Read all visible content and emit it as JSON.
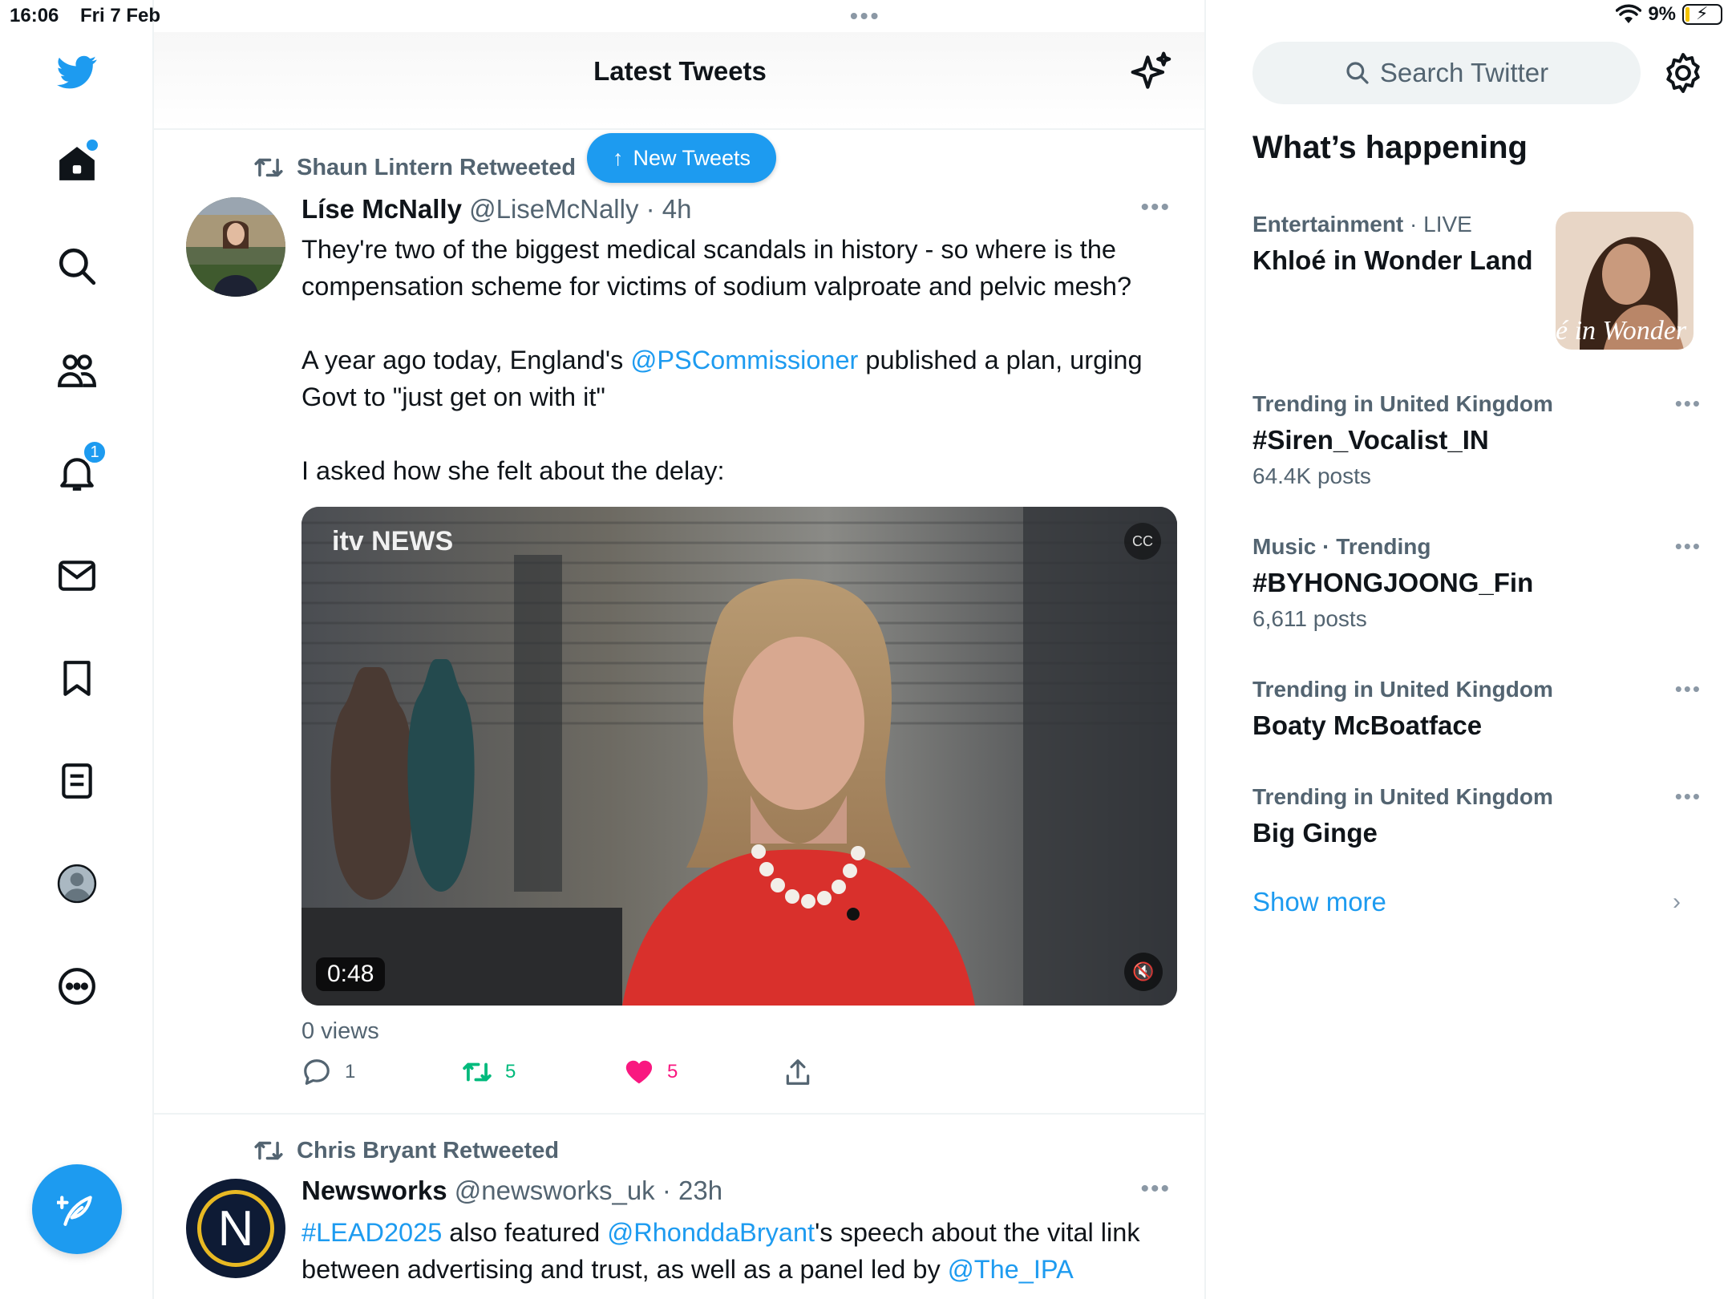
{
  "status_bar": {
    "time": "16:06",
    "date": "Fri 7 Feb",
    "battery": "9%",
    "top_dots": "•••"
  },
  "nav": {
    "notifications_badge": "1"
  },
  "header": {
    "title": "Latest Tweets"
  },
  "new_tweets_pill": {
    "label": "New Tweets"
  },
  "tweets": [
    {
      "retweeted_by": "Shaun Lintern Retweeted",
      "name": "Líse McNally",
      "handle": "@LiseMcNally",
      "time": "4h",
      "text_p1": "They're two of the biggest medical scandals in history - so where is the compensation scheme for victims of sodium valproate and pelvic mesh?",
      "text_p2_before": "A year ago today, England's ",
      "text_p2_mention": "@PSCommissioner",
      "text_p2_after": " published a plan, urging Govt to \"just get on with it\"",
      "text_p3": "I asked how she felt about the delay:",
      "video_logo": "itv NEWS",
      "video_duration": "0:48",
      "views": "0 views",
      "replies": "1",
      "retweets": "5",
      "likes": "5"
    },
    {
      "retweeted_by": "Chris Bryant Retweeted",
      "name": "Newsworks",
      "handle": "@newsworks_uk",
      "time": "23h",
      "avatar_letter": "N",
      "text_hashtag": "#LEAD2025",
      "text_mid1": " also featured ",
      "text_mention1": "@RhonddaBryant",
      "text_mid2": "'s speech about the vital link between advertising and trust, as well as a panel led by ",
      "text_mention2": "@The_IPA"
    }
  ],
  "sidebar": {
    "search_placeholder": "Search Twitter",
    "title": "What’s happening",
    "trends": [
      {
        "category": "Entertainment",
        "live": "LIVE",
        "topic": "Khloé in Wonder Land",
        "image_caption": "é in Wonder l"
      },
      {
        "meta": "Trending in United Kingdom",
        "topic": "#Siren_Vocalist_IN",
        "count": "64.4K posts"
      },
      {
        "meta": "Music · Trending",
        "topic": "#BYHONGJOONG_Fin",
        "count": "6,611 posts"
      },
      {
        "meta": "Trending in United Kingdom",
        "topic": "Boaty McBoatface"
      },
      {
        "meta": "Trending in United Kingdom",
        "topic": "Big Ginge"
      }
    ],
    "show_more": "Show more"
  },
  "colors": {
    "accent": "#1d9bf0",
    "retweet": "#00ba7c",
    "like": "#f91880",
    "muted": "#536471"
  }
}
